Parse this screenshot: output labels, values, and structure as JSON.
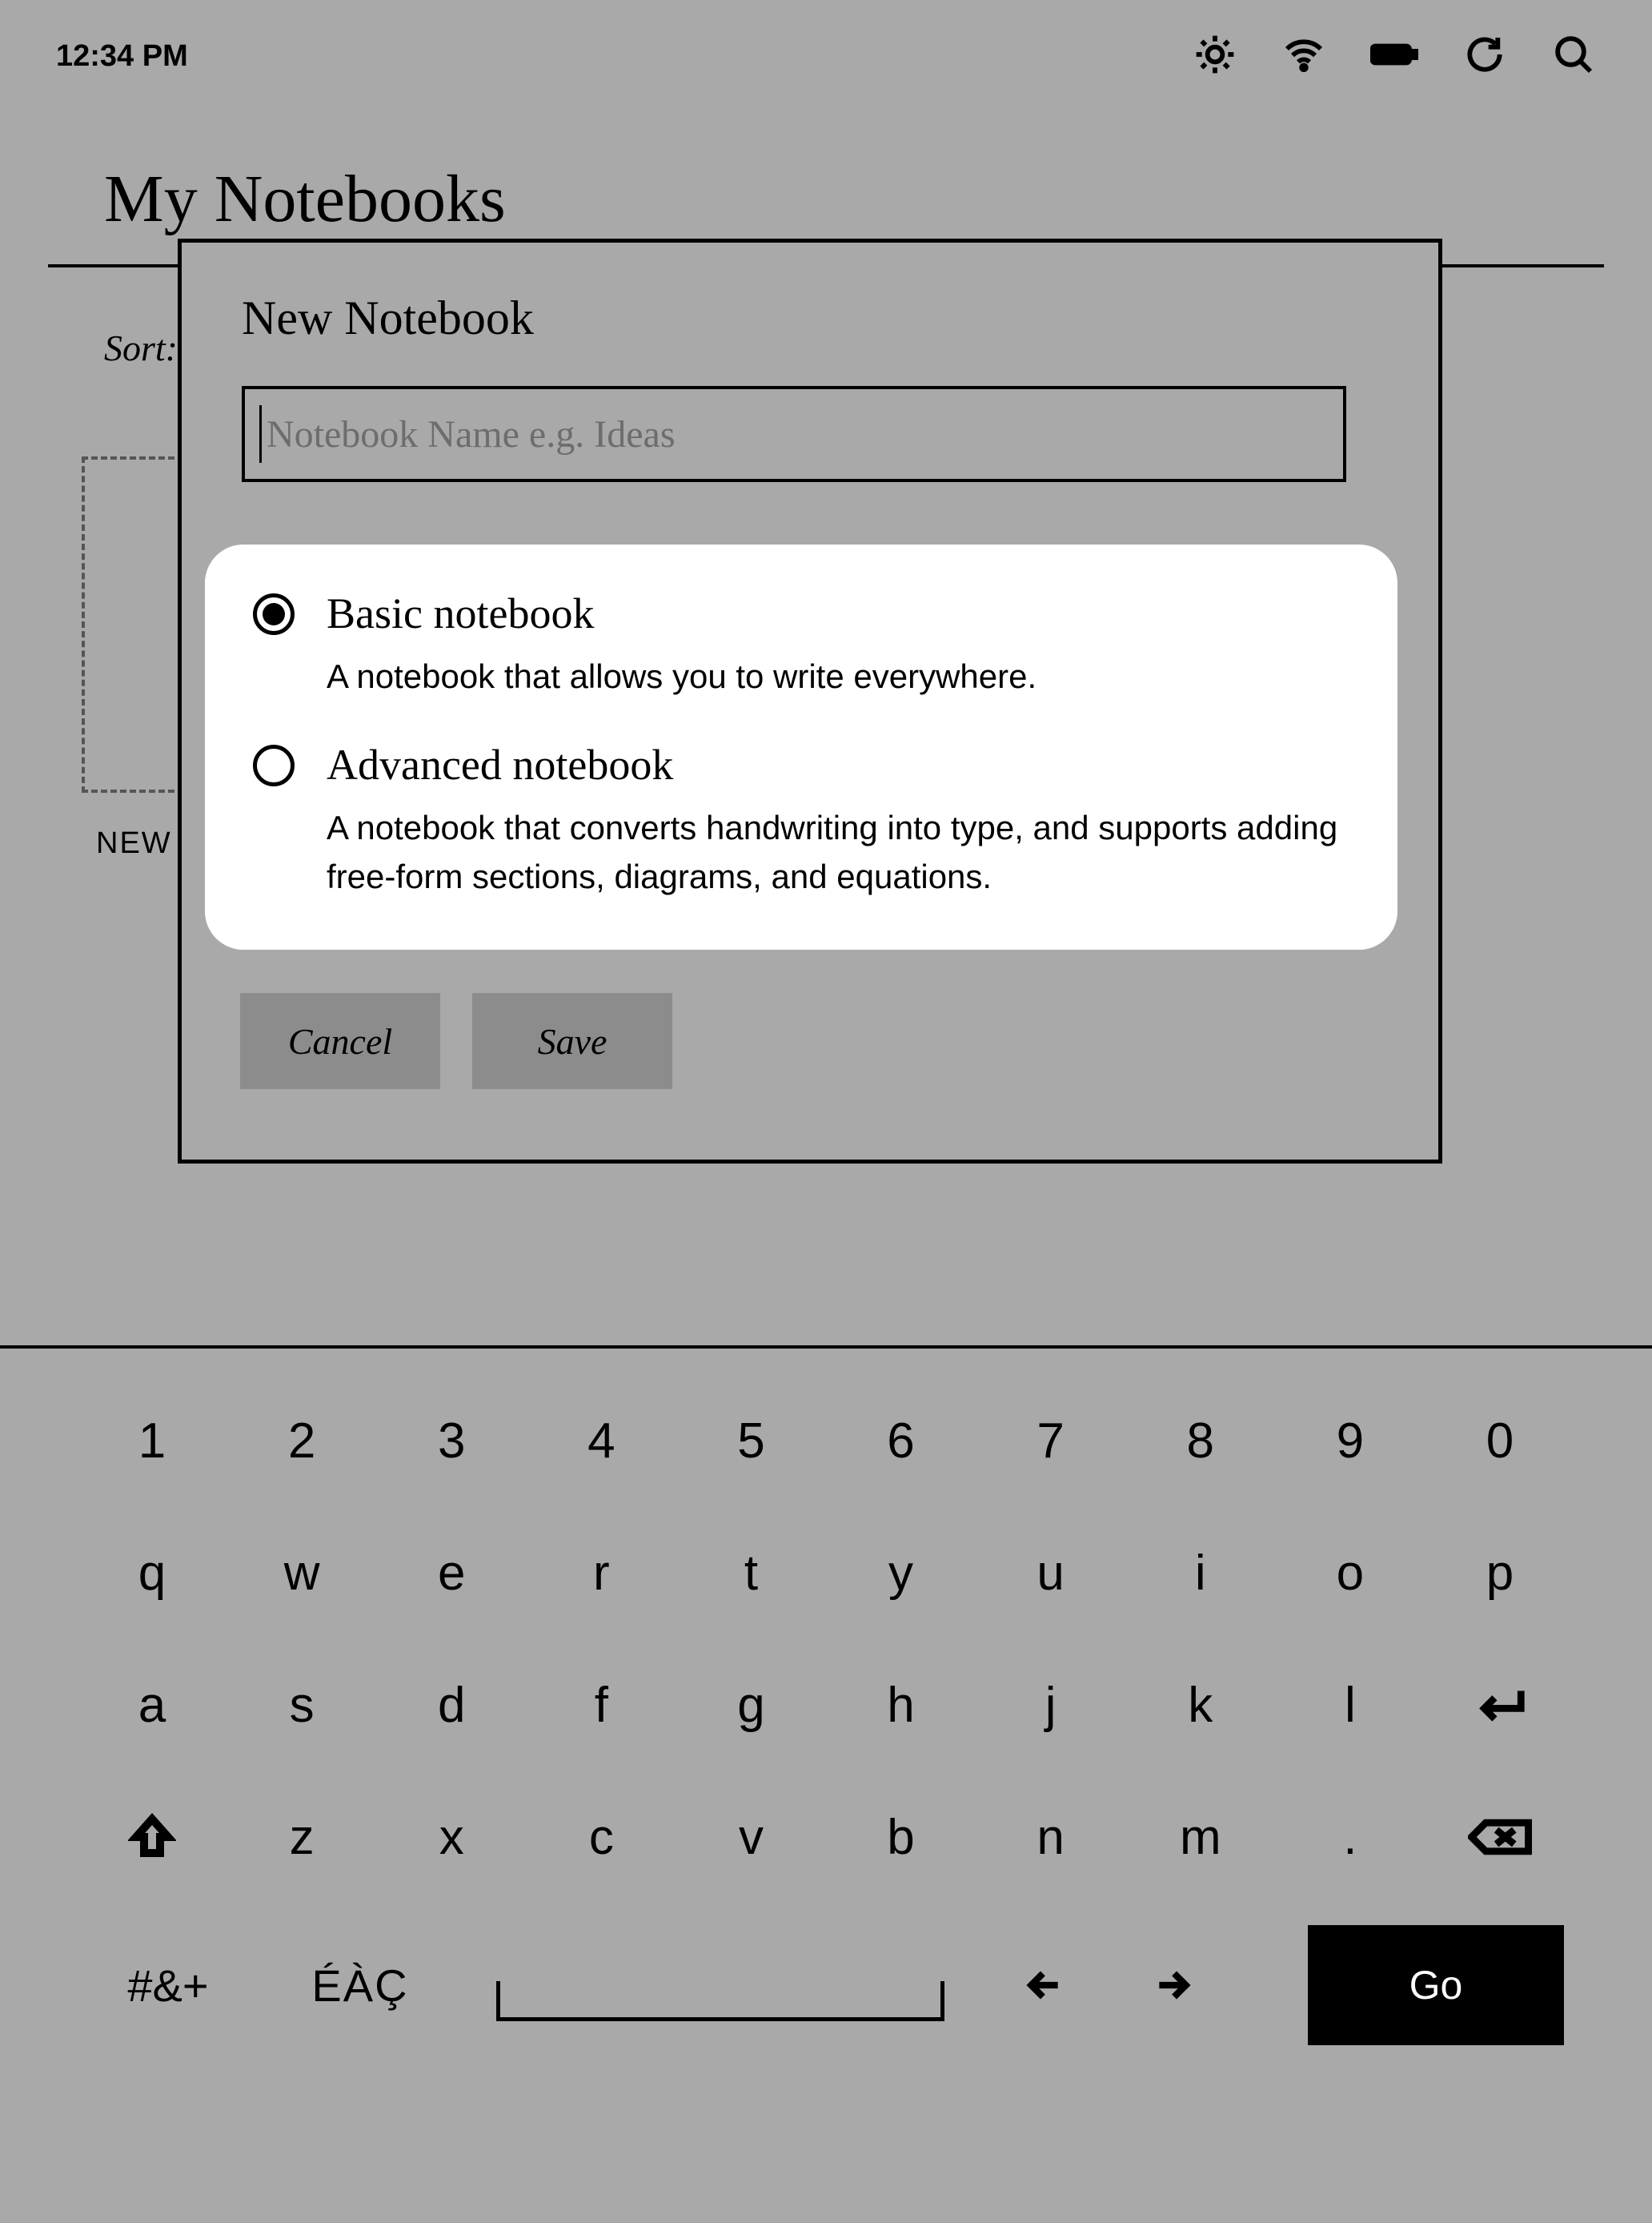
{
  "status": {
    "time": "12:34 PM",
    "icons": [
      "brightness",
      "wifi",
      "battery",
      "sync",
      "search"
    ]
  },
  "page": {
    "title": "My Notebooks",
    "sort_label": "Sort:",
    "new_tile_label": "NEW"
  },
  "modal": {
    "title": "New Notebook",
    "name_value": "",
    "name_placeholder": "Notebook Name e.g. Ideas",
    "options": [
      {
        "id": "basic",
        "selected": true,
        "title": "Basic notebook",
        "desc": "A notebook that allows you to write everywhere."
      },
      {
        "id": "advanced",
        "selected": false,
        "title": "Advanced notebook",
        "desc": "A notebook that converts handwriting into type, and supports adding free-form sections, diagrams, and equations."
      }
    ],
    "cancel_label": "Cancel",
    "save_label": "Save"
  },
  "keyboard": {
    "row1": [
      "1",
      "2",
      "3",
      "4",
      "5",
      "6",
      "7",
      "8",
      "9",
      "0"
    ],
    "row2": [
      "q",
      "w",
      "e",
      "r",
      "t",
      "y",
      "u",
      "i",
      "o",
      "p"
    ],
    "row3": [
      "a",
      "s",
      "d",
      "f",
      "g",
      "h",
      "j",
      "k",
      "l",
      "enter"
    ],
    "row4": [
      "shift",
      "z",
      "x",
      "c",
      "v",
      "b",
      "n",
      "m",
      ".",
      "backspace"
    ],
    "symbols_label": "#&+",
    "accent_label": "ÉÀÇ",
    "go_label": "Go"
  }
}
